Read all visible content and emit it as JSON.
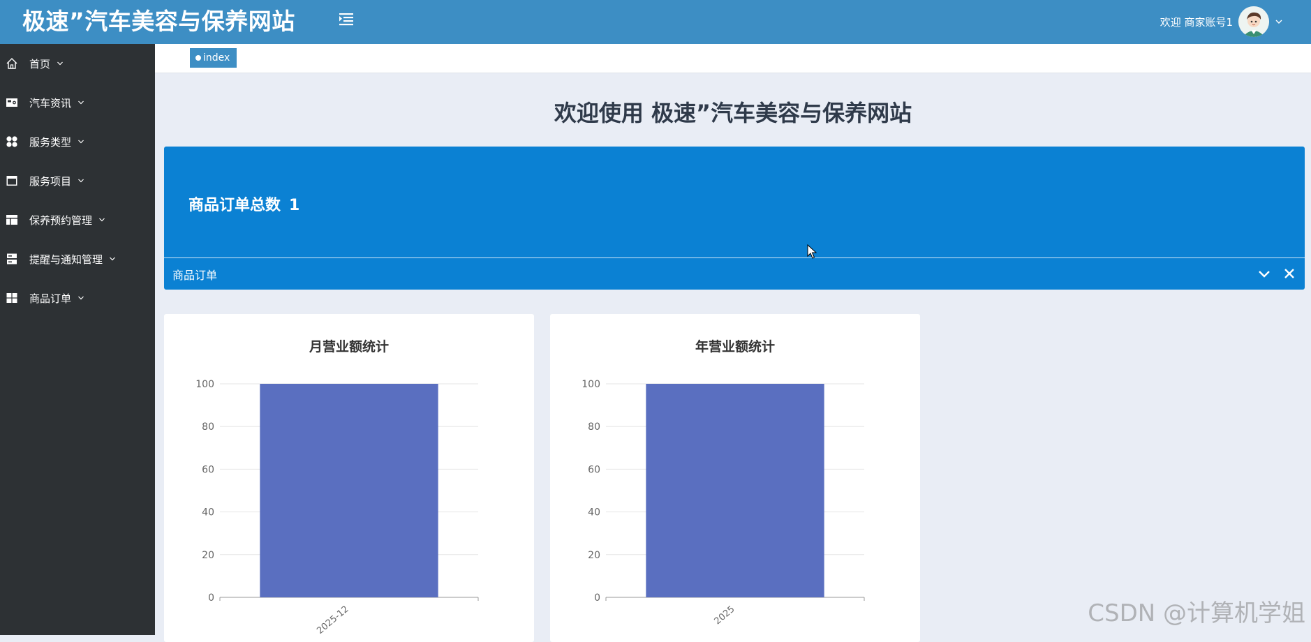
{
  "header": {
    "title": "极速”汽车美容与保养网站",
    "menu_icon": "menu-fold-icon",
    "welcome_text": "欢迎 商家账号1",
    "avatar_icon": "user-avatar-icon",
    "dropdown_icon": "chevron-down-icon"
  },
  "sidebar": {
    "items": [
      {
        "label": "首页",
        "icon": "home-icon"
      },
      {
        "label": "汽车资讯",
        "icon": "news-icon"
      },
      {
        "label": "服务类型",
        "icon": "grid-icon"
      },
      {
        "label": "服务项目",
        "icon": "window-icon"
      },
      {
        "label": "保养预约管理",
        "icon": "layout-icon"
      },
      {
        "label": "提醒与通知管理",
        "icon": "server-icon"
      },
      {
        "label": "商品订单",
        "icon": "table-icon"
      }
    ]
  },
  "tabs": {
    "active": "index"
  },
  "main": {
    "welcome": "欢迎使用 极速”汽车美容与保养网站",
    "stat": {
      "label": "商品订单总数",
      "value": "1",
      "footer": "商品订单"
    }
  },
  "colors": {
    "header": "#3d8ec4",
    "sidebar": "#2d3134",
    "stat_card": "#0b81d3",
    "bar": "#5a6fc0"
  },
  "chart_data": [
    {
      "type": "bar",
      "title": "月营业额统计",
      "categories": [
        "2025-12"
      ],
      "values": [
        100
      ],
      "ylim": [
        0,
        100
      ],
      "yticks": [
        0,
        20,
        40,
        60,
        80,
        100
      ],
      "grid": true
    },
    {
      "type": "bar",
      "title": "年营业额统计",
      "categories": [
        "2025"
      ],
      "values": [
        100
      ],
      "ylim": [
        0,
        100
      ],
      "yticks": [
        0,
        20,
        40,
        60,
        80,
        100
      ],
      "grid": true
    }
  ],
  "watermark": "CSDN @计算机学姐"
}
